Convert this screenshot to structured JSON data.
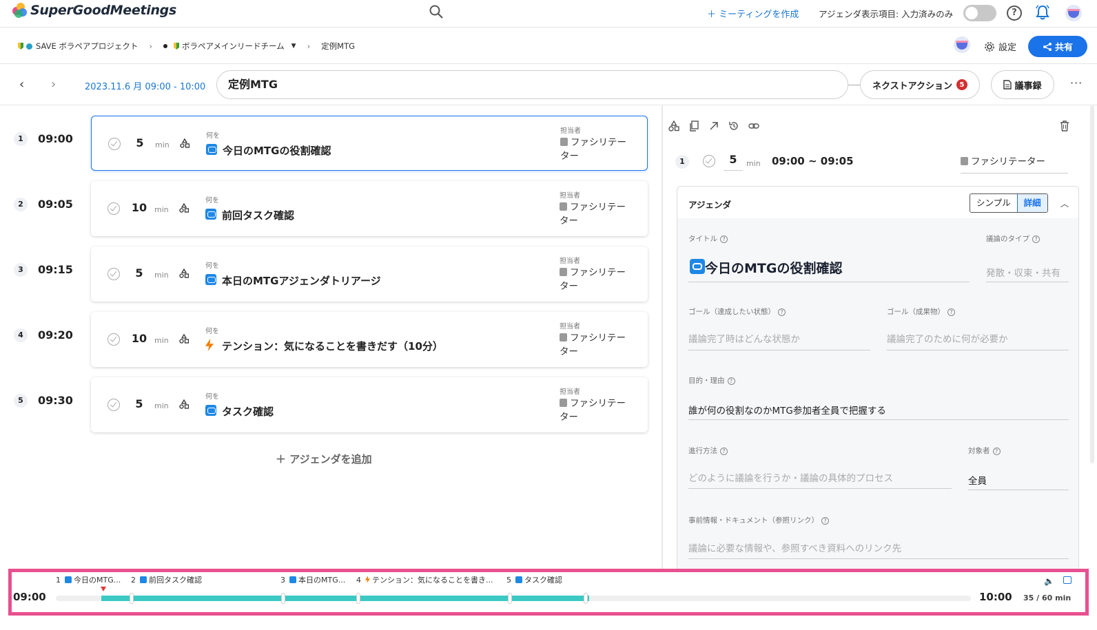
{
  "app": {
    "name": "SuperGoodMeetings",
    "create_meeting": "＋ ミーティングを作成",
    "agenda_display": "アジェンダ表示項目: 入力済みのみ"
  },
  "breadcrumb": {
    "project": "SAVE ボラペアプロジェクト",
    "team": "ボラペアメインリードチーム",
    "meeting": "定例MTG"
  },
  "header_actions": {
    "settings": "設定",
    "share": "共有"
  },
  "meeting": {
    "date_time": "2023.11.6 月 09:00 - 10:00",
    "title": "定例MTG",
    "next_action_label": "ネクストアクション",
    "next_action_count": "5",
    "minutes_label": "議事録",
    "more": "···"
  },
  "agenda_items": [
    {
      "num": "1",
      "time": "09:00",
      "duration": "5",
      "unit": "min",
      "what_label": "何を",
      "title": "今日のMTGの役割確認",
      "type": "loop",
      "owner_label": "担当者",
      "owner": "ファシリテーター"
    },
    {
      "num": "2",
      "time": "09:05",
      "duration": "10",
      "unit": "min",
      "what_label": "何を",
      "title": "前回タスク確認",
      "type": "loop",
      "owner_label": "担当者",
      "owner": "ファシリテーター"
    },
    {
      "num": "3",
      "time": "09:15",
      "duration": "5",
      "unit": "min",
      "what_label": "何を",
      "title": "本日のMTGアジェンダトリアージ",
      "type": "loop",
      "owner_label": "担当者",
      "owner": "ファシリテーター"
    },
    {
      "num": "4",
      "time": "09:20",
      "duration": "10",
      "unit": "min",
      "what_label": "何を",
      "title": "テンション：気になることを書きだす（10分）",
      "type": "bolt",
      "owner_label": "担当者",
      "owner": "ファシリテーター"
    },
    {
      "num": "5",
      "time": "09:30",
      "duration": "5",
      "unit": "min",
      "what_label": "何を",
      "title": "タスク確認",
      "type": "loop",
      "owner_label": "担当者",
      "owner": "ファシリテーター"
    }
  ],
  "add_agenda": "＋ アジェンダを追加",
  "detail": {
    "num": "1",
    "duration": "5",
    "unit": "min",
    "range": "09:00 ~ 09:05",
    "owner": "ファシリテーター",
    "section_title": "アジェンダ",
    "view_simple": "シンプル",
    "view_detail": "詳細",
    "collapse": "^",
    "fields": {
      "title_label": "タイトル",
      "title_value": "今日のMTGの役割確認",
      "discussion_type_label": "議論のタイプ",
      "discussion_type_placeholder": "発散・収束・共有",
      "goal_state_label": "ゴール（達成したい状態）",
      "goal_state_placeholder": "議論完了時はどんな状態か",
      "goal_output_label": "ゴール（成果物）",
      "goal_output_placeholder": "議論完了のために何が必要か",
      "purpose_label": "目的・理由",
      "purpose_value": "誰が何の役割なのかMTG参加者全員で把握する",
      "method_label": "進行方法",
      "method_placeholder": "どのように議論を行うか・議論の具体的プロセス",
      "audience_label": "対象者",
      "audience_value": "全員",
      "docs_label": "事前情報・ドキュメント（参照リンク）",
      "docs_placeholder": "議論に必要な情報や、参照すべき資料へのリンク先"
    }
  },
  "timeline": {
    "start": "09:00",
    "end": "10:00",
    "count": "35 / 60 min",
    "segments": [
      {
        "num": "1",
        "label": "今日のMTG..."
      },
      {
        "num": "2",
        "label": "前回タスク確認"
      },
      {
        "num": "3",
        "label": "本日のMTG..."
      },
      {
        "num": "4",
        "label": "テンション：気になることを書き..."
      },
      {
        "num": "5",
        "label": "タスク確認"
      }
    ]
  },
  "colors": {
    "accent": "#1a73e8",
    "timeline_fill": "#3cc9c3",
    "timeline_border": "#e8508f",
    "badge": "#d32f2f"
  }
}
